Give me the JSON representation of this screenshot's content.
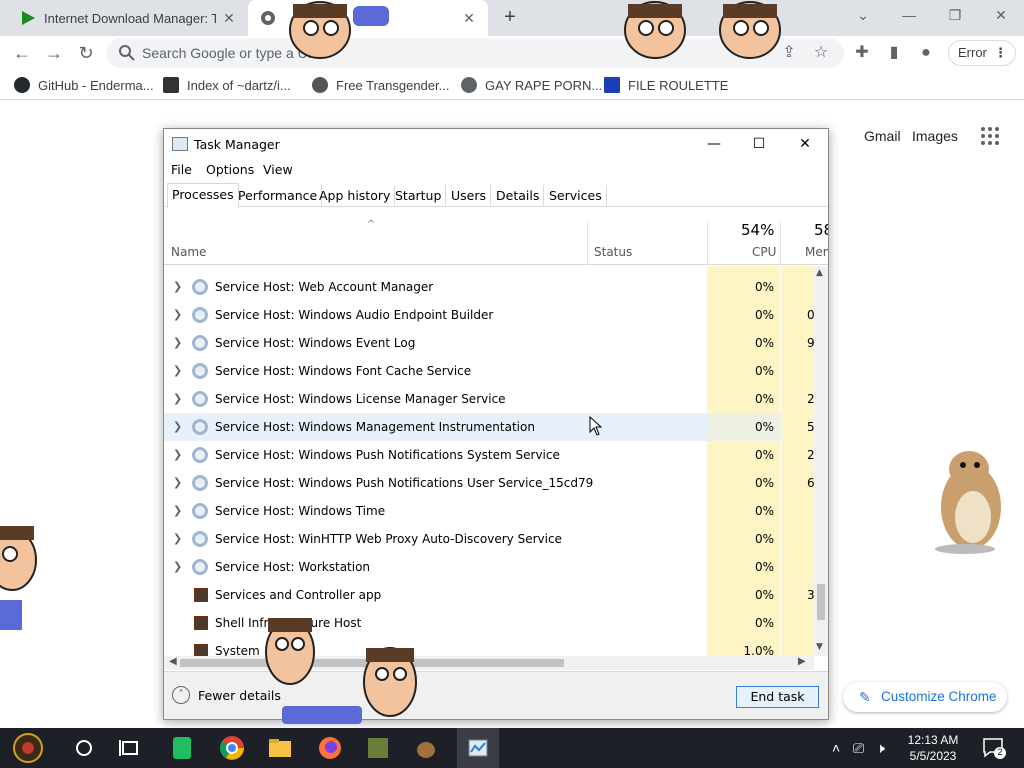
{
  "browser": {
    "tabs": [
      {
        "title": "Internet Download Manager: T",
        "active": false,
        "icon": "idm-play-icon"
      },
      {
        "title": "",
        "active": true,
        "icon": "chrome-icon"
      }
    ],
    "new_tab": "+",
    "omnibox_placeholder": "Search Google or type a URL",
    "profile_button": "Error",
    "bookmarks": [
      {
        "label": "GitHub - Enderma...",
        "icon": "github-icon"
      },
      {
        "label": "Index of ~dartz/i...",
        "icon": "page-icon"
      },
      {
        "label": "Free Transgender...",
        "icon": "mask-icon"
      },
      {
        "label": "GAY RAPE PORN...",
        "icon": "globe-icon"
      },
      {
        "label": "FILE ROULETTE",
        "icon": "file-icon"
      }
    ]
  },
  "google": {
    "gmail": "Gmail",
    "images": "Images",
    "customize": "Customize Chrome"
  },
  "task_manager": {
    "title": "Task Manager",
    "menu": [
      "File",
      "Options",
      "View"
    ],
    "tabs": [
      "Processes",
      "Performance",
      "App history",
      "Startup",
      "Users",
      "Details",
      "Services"
    ],
    "active_tab": "Processes",
    "columns": {
      "name": "Name",
      "status": "Status",
      "cpu_pct": "54%",
      "cpu": "CPU",
      "mem_pct": "58",
      "mem": "Mem"
    },
    "rows": [
      {
        "name": "Service Host: Web Account Manager",
        "cpu": "0%",
        "mem": "",
        "type": "service"
      },
      {
        "name": "Service Host: Windows Audio Endpoint Builder",
        "cpu": "0%",
        "mem": "0",
        "type": "service"
      },
      {
        "name": "Service Host: Windows Event Log",
        "cpu": "0%",
        "mem": "9",
        "type": "service"
      },
      {
        "name": "Service Host: Windows Font Cache Service",
        "cpu": "0%",
        "mem": "",
        "type": "service"
      },
      {
        "name": "Service Host: Windows License Manager Service",
        "cpu": "0%",
        "mem": "2",
        "type": "service"
      },
      {
        "name": "Service Host: Windows Management Instrumentation",
        "cpu": "0%",
        "mem": "5",
        "type": "service",
        "highlight": true
      },
      {
        "name": "Service Host: Windows Push Notifications System Service",
        "cpu": "0%",
        "mem": "2",
        "type": "service"
      },
      {
        "name": "Service Host: Windows Push Notifications User Service_15cd79",
        "cpu": "0%",
        "mem": "6",
        "type": "service"
      },
      {
        "name": "Service Host: Windows Time",
        "cpu": "0%",
        "mem": "",
        "type": "service"
      },
      {
        "name": "Service Host: WinHTTP Web Proxy Auto-Discovery Service",
        "cpu": "0%",
        "mem": "",
        "type": "service"
      },
      {
        "name": "Service Host: Workstation",
        "cpu": "0%",
        "mem": "",
        "type": "service"
      },
      {
        "name": "Services and Controller app",
        "cpu": "0%",
        "mem": "3",
        "type": "app"
      },
      {
        "name": "Shell Infrastructure Host",
        "cpu": "0%",
        "mem": "",
        "type": "app"
      },
      {
        "name": "System",
        "cpu": "1.0%",
        "mem": "",
        "type": "app"
      }
    ],
    "fewer_details": "Fewer details",
    "end_task": "End task"
  },
  "taskbar": {
    "time": "12:13 AM",
    "date": "5/5/2023",
    "notification_count": "2"
  },
  "colors": {
    "tabstrip": "#dee1e6",
    "cpu_heat": "#fff4c4",
    "highlight_row": "#e8f0fb",
    "taskbar": "#1d2027",
    "accent_blue": "#1a73e8"
  }
}
